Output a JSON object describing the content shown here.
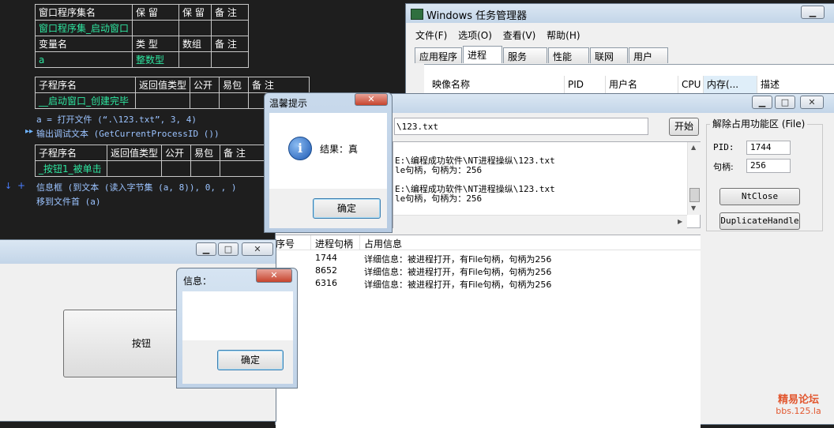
{
  "editor": {
    "t1": {
      "h": [
        "窗口程序集名",
        "保 留",
        "保 留",
        "备 注"
      ],
      "r": [
        "窗口程序集_启动窗口",
        "",
        "",
        ""
      ]
    },
    "t2": {
      "h": [
        "变量名",
        "类 型",
        "数组",
        "备 注"
      ],
      "r": [
        "a",
        "整数型",
        "",
        ""
      ]
    },
    "t3": {
      "h": [
        "子程序名",
        "返回值类型",
        "公开",
        "易包",
        "备 注"
      ],
      "r": [
        "__启动窗口_创建完毕",
        "",
        "",
        "",
        ""
      ]
    },
    "line1": "a = 打开文件 (“.\\123.txt”, 3, 4)",
    "line2": "输出调试文本 (GetCurrentProcessID ())",
    "t4": {
      "h": [
        "子程序名",
        "返回值类型",
        "公开",
        "易包",
        "备 注"
      ],
      "r": [
        "_按钮1_被单击",
        "",
        "",
        "",
        ""
      ]
    },
    "line3_marker": "+",
    "line3": "信息框 (到文本 (读入字节集 (a, 8)), 0, , )",
    "line4": "移到文件首 (a)"
  },
  "taskmgr": {
    "title": "Windows 任务管理器",
    "menu": [
      "文件(F)",
      "选项(O)",
      "查看(V)",
      "帮助(H)"
    ],
    "tabs": [
      "应用程序",
      "进程",
      "服务",
      "性能",
      "联网",
      "用户"
    ],
    "columns": [
      "映像名称",
      "PID",
      "用户名",
      "CPU",
      "内存(...",
      "描述"
    ]
  },
  "tool": {
    "path_suffix": "\\123.txt",
    "start_button": "开始",
    "log": [
      "E:\\编程成功软件\\NT进程操纵\\123.txt",
      "le句柄，句柄为：256",
      "",
      "E:\\编程成功软件\\NT进程操纵\\123.txt",
      "le句柄，句柄为：256"
    ],
    "group_title": "解除占用功能区 (File)",
    "pid_label": "PID:",
    "pid_value": "1744",
    "handle_label": "句柄:",
    "handle_value": "256",
    "ntclose": "NtClose",
    "duplicate": "DuplicateHandle",
    "list_headers": [
      "序号",
      "进程句柄",
      "占用信息"
    ],
    "rows": [
      {
        "pid": "1744",
        "info": "详细信息：被进程打开，有File句柄，句柄为256"
      },
      {
        "pid": "8652",
        "info": "详细信息：被进程打开，有File句柄，句柄为256"
      },
      {
        "pid": "6316",
        "info": "详细信息：被进程打开，有File句柄，句柄为256"
      }
    ]
  },
  "tip_dialog": {
    "title": "温馨提示",
    "message": "结果：真",
    "ok": "确定"
  },
  "app_window": {
    "button": "按钮"
  },
  "info_dialog": {
    "title": "信息：",
    "ok": "确定"
  },
  "watermark": {
    "line1": "精易论坛",
    "line2": "bbs.125.la"
  }
}
